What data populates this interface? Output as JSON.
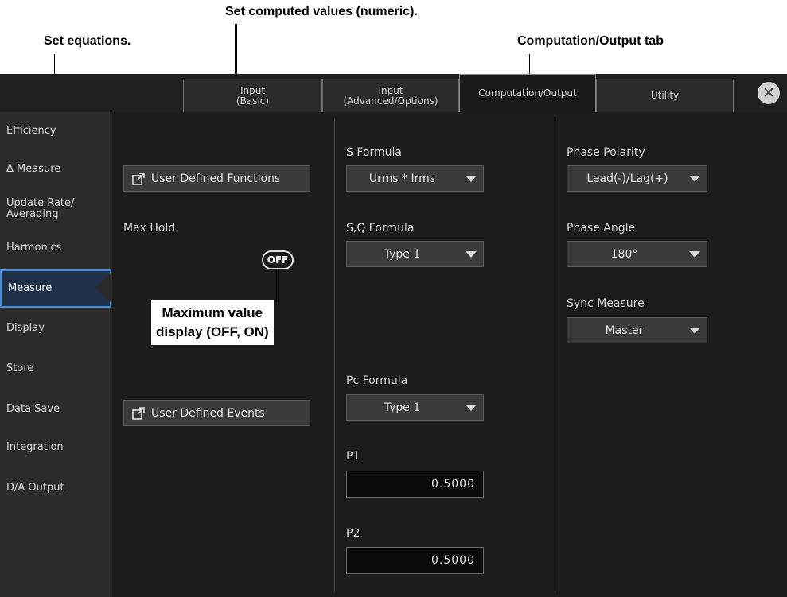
{
  "callouts": {
    "set_computed_values": "Set computed values (numeric).",
    "set_equations": "Set equations.",
    "computation_output_tab": "Computation/Output tab",
    "max_value_display": "Maximum value\ndisplay (OFF, ON)"
  },
  "tabs": [
    {
      "label": "Input\n(Basic)"
    },
    {
      "label": "Input\n(Advanced/Options)"
    },
    {
      "label": "Computation/Output",
      "active": true
    },
    {
      "label": "Utility"
    }
  ],
  "sidebar": {
    "items": [
      {
        "label": "Efficiency"
      },
      {
        "label": "Δ Measure"
      },
      {
        "label": "Update Rate/\nAveraging"
      },
      {
        "label": "Harmonics"
      },
      {
        "label": "Measure",
        "active": true
      },
      {
        "label": "Display"
      },
      {
        "label": "Store"
      },
      {
        "label": "Data Save"
      },
      {
        "label": "Integration"
      },
      {
        "label": "D/A Output"
      }
    ]
  },
  "col1": {
    "user_defined_functions": "User Defined Functions",
    "max_hold_label": "Max Hold",
    "max_hold_value": "OFF",
    "user_defined_events": "User Defined Events"
  },
  "col2": {
    "s_formula_label": "S Formula",
    "s_formula_value": "Urms * Irms",
    "sq_formula_label": "S,Q Formula",
    "sq_formula_value": "Type 1",
    "pc_formula_label": "Pc Formula",
    "pc_formula_value": "Type 1",
    "p1_label": "P1",
    "p1_value": "0.5000",
    "p2_label": "P2",
    "p2_value": "0.5000"
  },
  "col3": {
    "phase_polarity_label": "Phase Polarity",
    "phase_polarity_value": "Lead(-)/Lag(+)",
    "phase_angle_label": "Phase Angle",
    "phase_angle_value": "180°",
    "sync_measure_label": "Sync Measure",
    "sync_measure_value": "Master"
  },
  "colors": {
    "accent": "#3d8ee8",
    "background": "#1c1c1c"
  },
  "icons": {
    "close": "close-icon",
    "external": "external-link-icon",
    "dropdown": "chevron-down-icon"
  }
}
